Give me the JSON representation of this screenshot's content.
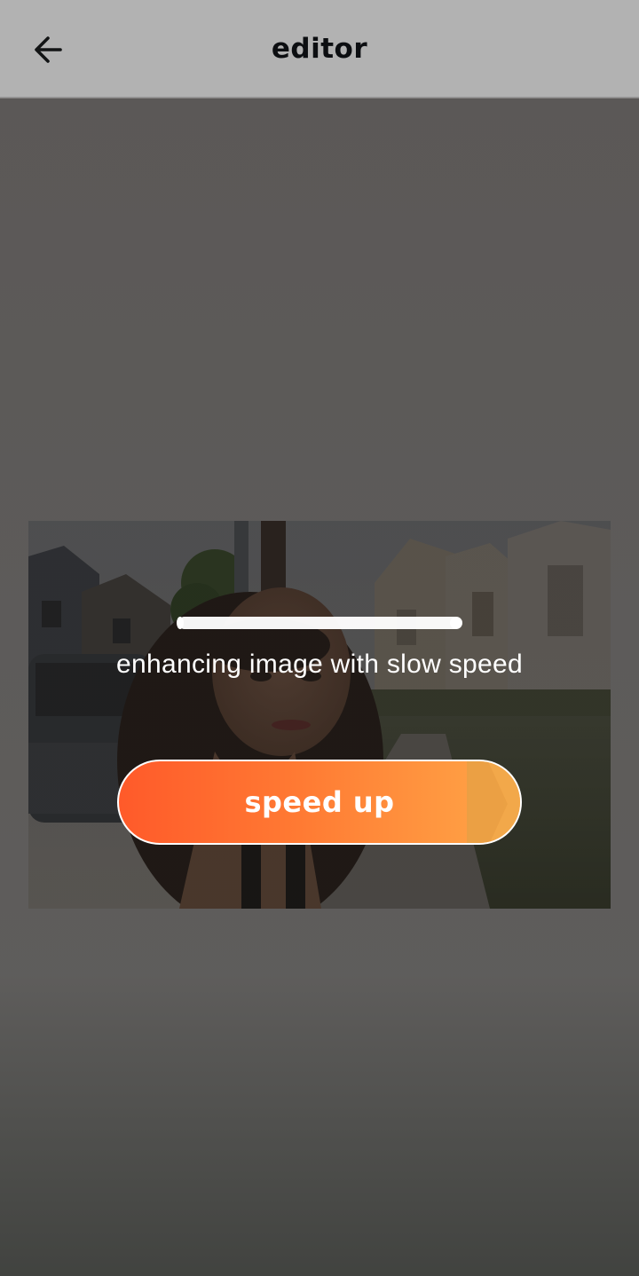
{
  "app_bar": {
    "title": "editor",
    "back_icon": "arrow-left-icon"
  },
  "processing": {
    "status_text": "enhancing image with slow speed",
    "progress": 1.0,
    "action_label": "speed up"
  },
  "colors": {
    "button_start": "#ff5a2a",
    "button_end": "#ffa848",
    "text_on_overlay": "#ffffff"
  }
}
